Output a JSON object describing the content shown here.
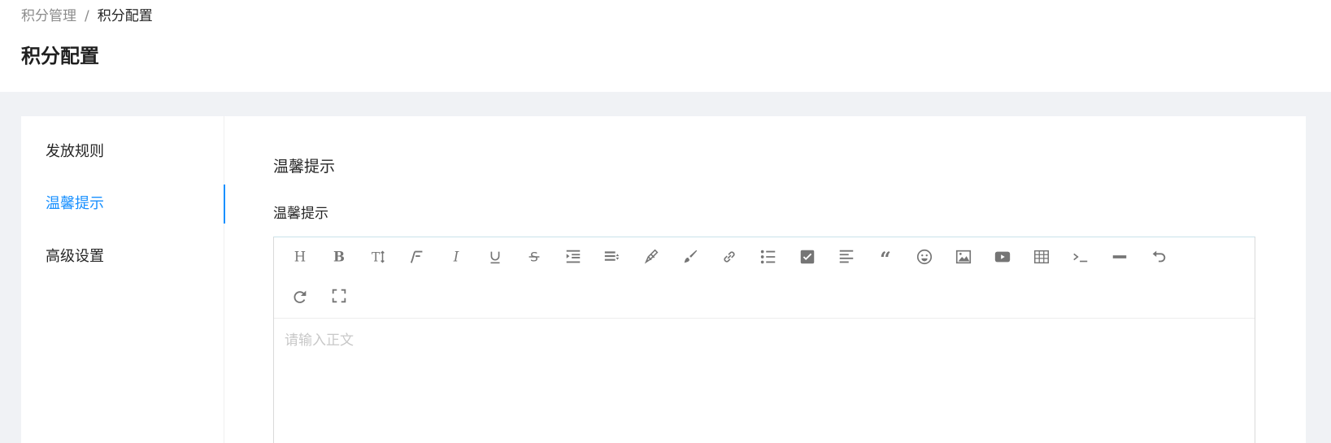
{
  "breadcrumb": {
    "parent": "积分管理",
    "separator": "/",
    "current": "积分配置"
  },
  "page": {
    "title": "积分配置"
  },
  "menu": {
    "items": [
      {
        "label": "发放规则",
        "active": false
      },
      {
        "label": "温馨提示",
        "active": true
      },
      {
        "label": "高级设置",
        "active": false
      }
    ]
  },
  "content": {
    "section_title": "温馨提示",
    "field_label": "温馨提示"
  },
  "editor": {
    "placeholder": "请输入正文",
    "toolbar": [
      "heading-icon",
      "bold-icon",
      "font-size-icon",
      "font-family-icon",
      "italic-icon",
      "underline-icon",
      "strikethrough-icon",
      "indent-icon",
      "line-height-icon",
      "text-color-icon",
      "background-color-icon",
      "link-icon",
      "list-icon",
      "todo-icon",
      "align-icon",
      "quote-icon",
      "emoji-icon",
      "image-icon",
      "video-icon",
      "table-icon",
      "code-icon",
      "divider-icon",
      "undo-icon",
      "redo-icon",
      "fullscreen-icon"
    ]
  },
  "colors": {
    "accent": "#1890ff",
    "icon": "#757575",
    "placeholder": "#c8c8c8"
  }
}
